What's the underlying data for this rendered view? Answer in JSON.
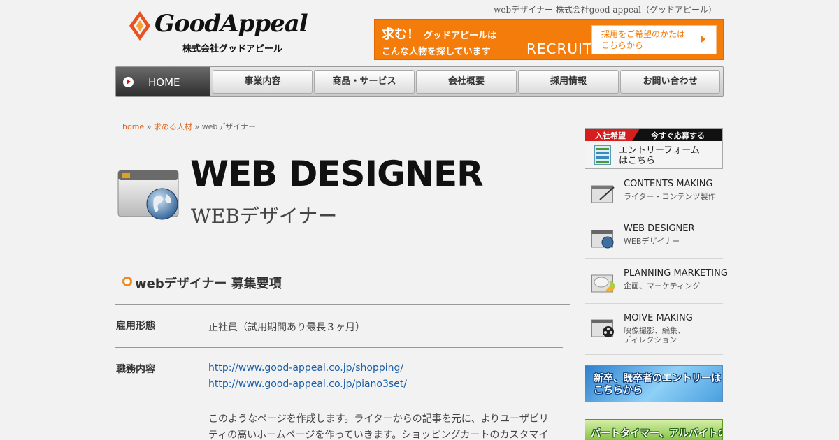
{
  "header": {
    "tagline": "webデザイナー 株式会社good appeal（グッドアピール）",
    "logo_text": "GoodAppeal",
    "logo_sub": "株式会社グッドアピール",
    "recruit_banner": {
      "lead": "求む！",
      "line1": "グッドアピールは",
      "line2": "こんな人物を探しています",
      "recruit_label": "RECRUIT",
      "cta_label": "採用をご希望のかたは こちらから",
      "accent_color": "#f47c0a"
    }
  },
  "nav": {
    "home_label": "HOME",
    "items": [
      "事業内容",
      "商品・サービス",
      "会社概要",
      "採用情報",
      "お問い合わせ"
    ]
  },
  "breadcrumb": {
    "home": "home",
    "sep1": "»",
    "section": "求める人材",
    "sep2": "»",
    "current": "webデザイナー"
  },
  "hero": {
    "title": "WEB DESIGNER",
    "subtitle": "WEBデザイナー"
  },
  "job": {
    "section_title": "webデザイナー 募集要項",
    "rows": [
      {
        "label": "雇用形態",
        "value": "正社員（試用期間あり最長３ヶ月）"
      },
      {
        "label": "職務内容",
        "links": [
          "http://www.good-appeal.co.jp/shopping/",
          "http://www.good-appeal.co.jp/piano3set/"
        ]
      }
    ],
    "description": "このようなページを作成します。ライターからの記事を元に、よりユーザビリティの高いホームページを作っていきます。ショッピングカートのカスタマイ"
  },
  "sidebar": {
    "entry": {
      "tag1": "入社希望",
      "tag2": "今すぐ応募する",
      "text_line1": "エントリーフォーム",
      "text_line2": "はこちら"
    },
    "items": [
      {
        "title": "CONTENTS MAKING",
        "sub": "ライター・コンテンツ製作",
        "icon": "pen-icon"
      },
      {
        "title": "WEB DESIGNER",
        "sub": "WEBデザイナー",
        "icon": "globe-icon"
      },
      {
        "title": "PLANNING MARKETING",
        "sub": "企画、マーケティング",
        "icon": "chart-icon"
      },
      {
        "title": "MOIVE MAKING",
        "sub": "映像撮影、編集、",
        "sub2": "ディレクション",
        "icon": "film-reel-icon"
      }
    ],
    "banner_new": "新卒、既卒者のエントリーはこちらから",
    "banner_part": "パートタイマー、アルバイトの"
  }
}
